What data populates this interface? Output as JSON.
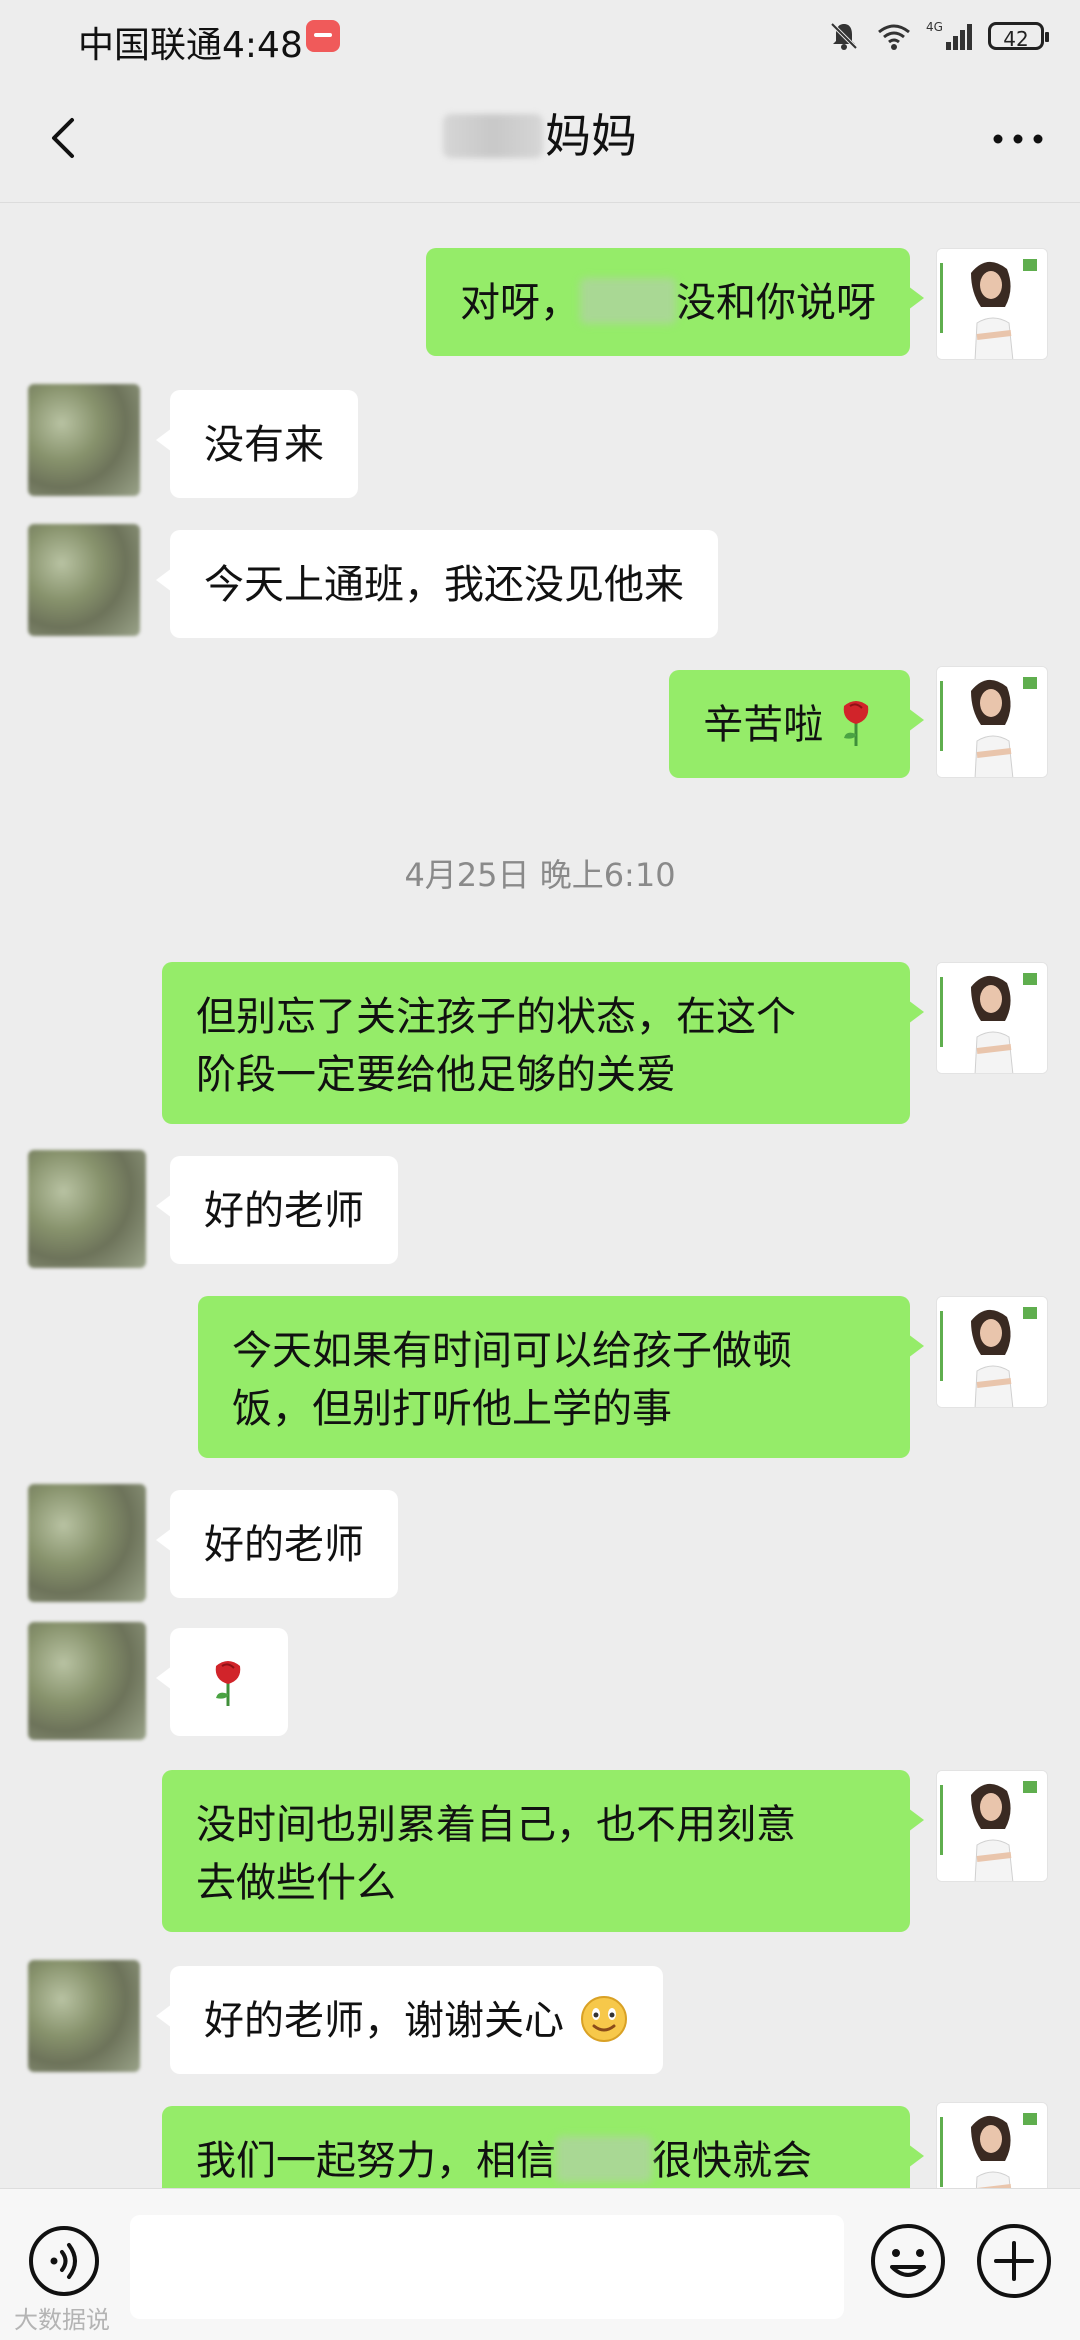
{
  "status_bar": {
    "carrier": "中国联通",
    "time": "4:48",
    "network": "4G",
    "battery": "42"
  },
  "header": {
    "title_suffix": "妈妈"
  },
  "messages": [
    {
      "sender": "self",
      "pre": "对呀，",
      "post": "没和你说呀"
    },
    {
      "sender": "other",
      "text": "没有来"
    },
    {
      "sender": "other",
      "text": "今天上通班，我还没见他来"
    },
    {
      "sender": "self",
      "text": "辛苦啦"
    },
    {
      "sender": "self",
      "line1": "但别忘了关注孩子的状态，在这个",
      "line2": "阶段一定要给他足够的关爱"
    },
    {
      "sender": "other",
      "text": "好的老师"
    },
    {
      "sender": "self",
      "line1": "今天如果有时间可以给孩子做顿",
      "line2": "饭，但别打听他上学的事"
    },
    {
      "sender": "other",
      "text": "好的老师"
    },
    {
      "sender": "other",
      "text": ""
    },
    {
      "sender": "self",
      "line1": "没时间也别累着自己，也不用刻意",
      "line2": "去做些什么"
    },
    {
      "sender": "other",
      "text": "好的老师，谢谢关心"
    },
    {
      "sender": "self",
      "pre": "我们一起努力，相信",
      "post": "很快就会"
    }
  ],
  "timestamp": "4月25日 晚上6:10",
  "input": {
    "value": "",
    "placeholder": ""
  },
  "icons": {
    "back": "chevron-left-icon",
    "more": "more-dots-icon",
    "voice": "voice-icon",
    "emoji": "emoji-icon",
    "plus": "plus-icon"
  },
  "colors": {
    "self_bubble": "#95ec69",
    "other_bubble": "#ffffff",
    "background": "#ededed"
  },
  "watermark": "大数据说"
}
